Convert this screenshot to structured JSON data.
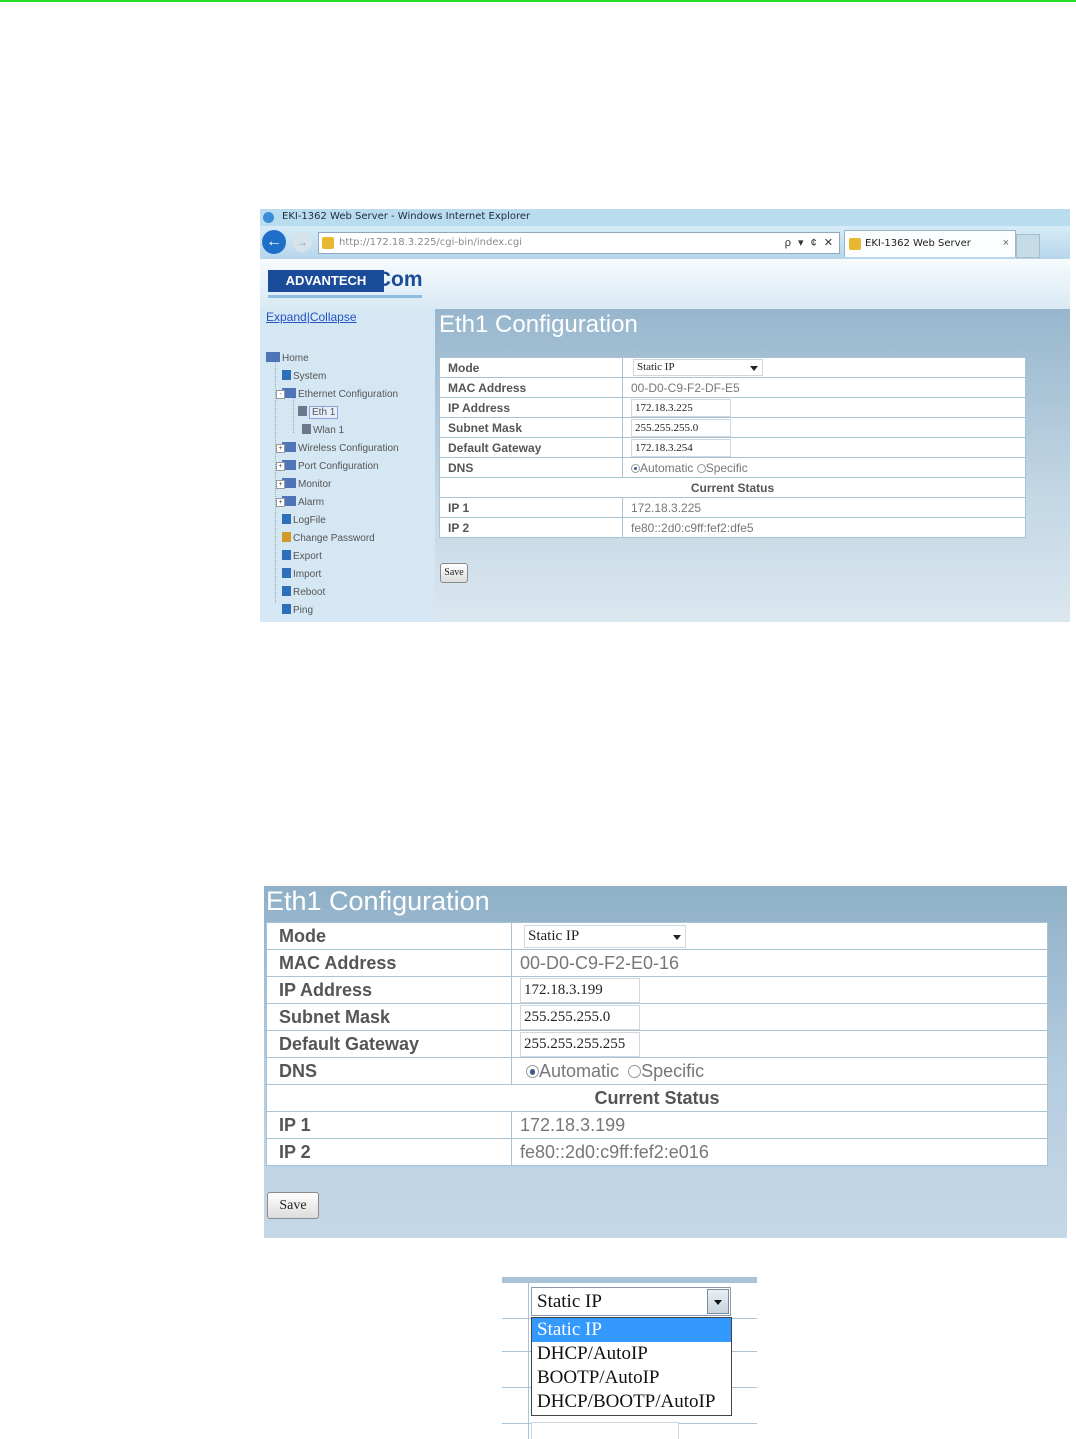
{
  "browser": {
    "window_title": "EKI-1362 Web Server - Windows Internet Explorer",
    "url": "http://172.18.3.225/cgi-bin/index.cgi",
    "address_controls": "ρ ▾ ¢ ✕",
    "tab_title": "EKI-1362 Web Server",
    "tab_close": "×"
  },
  "brand": {
    "advantech": "ADVANTECH",
    "icom": "iCom"
  },
  "sidebar": {
    "expand": "Expand",
    "separator": "|",
    "collapse": "Collapse",
    "items": [
      {
        "label": "Home"
      },
      {
        "label": "System"
      },
      {
        "label": "Ethernet Configuration"
      },
      {
        "label": "Eth 1"
      },
      {
        "label": "Wlan 1"
      },
      {
        "label": "Wireless Configuration"
      },
      {
        "label": "Port Configuration"
      },
      {
        "label": "Monitor"
      },
      {
        "label": "Alarm"
      },
      {
        "label": "LogFile"
      },
      {
        "label": "Change Password"
      },
      {
        "label": "Export"
      },
      {
        "label": "Import"
      },
      {
        "label": "Reboot"
      },
      {
        "label": "Ping"
      }
    ]
  },
  "shot1": {
    "heading": "Eth1 Configuration",
    "labels": {
      "mode": "Mode",
      "mac": "MAC Address",
      "ip": "IP Address",
      "subnet": "Subnet Mask",
      "gateway": "Default Gateway",
      "dns": "DNS",
      "current_status": "Current Status",
      "ip1": "IP 1",
      "ip2": "IP 2"
    },
    "values": {
      "mode": "Static IP",
      "mac": "00-D0-C9-F2-DF-E5",
      "ip": "172.18.3.225",
      "subnet": "255.255.255.0",
      "gateway": "172.18.3.254",
      "dns_automatic": "Automatic",
      "dns_specific": "Specific",
      "ip1": "172.18.3.225",
      "ip2": "fe80::2d0:c9ff:fef2:dfe5"
    },
    "save": "Save"
  },
  "shot2": {
    "heading": "Eth1 Configuration",
    "labels": {
      "mode": "Mode",
      "mac": "MAC Address",
      "ip": "IP Address",
      "subnet": "Subnet Mask",
      "gateway": "Default Gateway",
      "dns": "DNS",
      "current_status": "Current Status",
      "ip1": "IP 1",
      "ip2": "IP 2"
    },
    "values": {
      "mode": "Static IP",
      "mac": "00-D0-C9-F2-E0-16",
      "ip": "172.18.3.199",
      "subnet": "255.255.255.0",
      "gateway": "255.255.255.255",
      "dns_automatic": "Automatic",
      "dns_specific": "Specific",
      "ip1": "172.18.3.199",
      "ip2": "fe80::2d0:c9ff:fef2:e016"
    },
    "save": "Save"
  },
  "mode_dropdown": {
    "selected": "Static IP",
    "options": [
      "Static IP",
      "DHCP/AutoIP",
      "BOOTP/AutoIP",
      "DHCP/BOOTP/AutoIP"
    ]
  },
  "colors": {
    "accent_line": "#22dd22",
    "brand_blue": "#1b4c9a",
    "panel_blue": "#97b6cd",
    "highlight": "#3399ff"
  }
}
